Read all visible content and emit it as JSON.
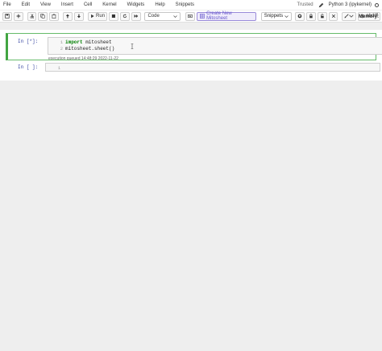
{
  "menubar": {
    "items": [
      "File",
      "Edit",
      "View",
      "Insert",
      "Cell",
      "Kernel",
      "Widgets",
      "Help",
      "Snippets"
    ],
    "trusted": "Trusted",
    "kernel_name": "Python 3 (ipykernel)"
  },
  "toolbar": {
    "run_label": "Run",
    "cell_type": "Code",
    "mitosheet_label": "Create New Mitosheet",
    "snippets_label": "Snippets",
    "nbdiff_label": "nbdiff",
    "memory_label": "Memory:"
  },
  "cells": [
    {
      "prompt": "In [*]:",
      "lines": [
        {
          "num": "1",
          "keyword": "import",
          "rest": " mitosheet"
        },
        {
          "num": "2",
          "keyword": "",
          "rest": "mitosheet.sheet()"
        }
      ],
      "status": "execution queued 14:48:29 2022-11-22"
    },
    {
      "prompt": "In [ ]:",
      "lines": [
        {
          "num": "1",
          "keyword": "",
          "rest": ""
        }
      ]
    }
  ]
}
